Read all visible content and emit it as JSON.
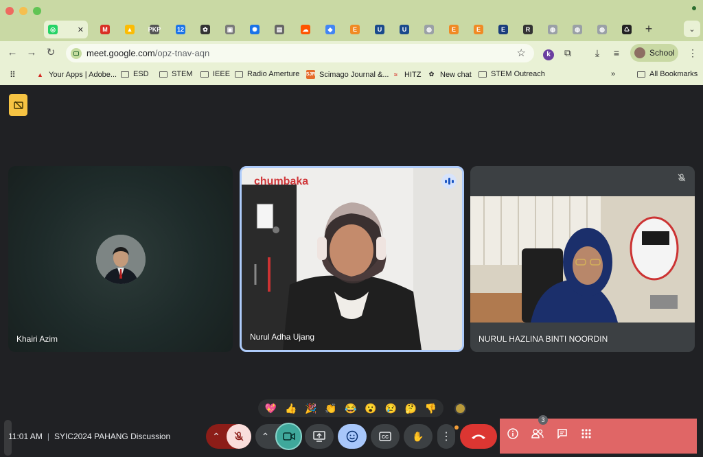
{
  "browser": {
    "tabs": [
      {
        "name": "whatsapp",
        "color": "#25d366",
        "glyph": "◎"
      },
      {
        "name": "gmail",
        "color": "#d93025",
        "glyph": "M"
      },
      {
        "name": "google-drive",
        "color": "#fbbc04",
        "glyph": "▲"
      },
      {
        "name": "pkp",
        "color": "#555555",
        "glyph": "PKP"
      },
      {
        "name": "calendar",
        "color": "#1a73e8",
        "glyph": "12"
      },
      {
        "name": "chatgpt",
        "color": "#333333",
        "glyph": "✿"
      },
      {
        "name": "portal",
        "color": "#7a7a7a",
        "glyph": "▣"
      },
      {
        "name": "settings",
        "color": "#1a73e8",
        "glyph": "✺"
      },
      {
        "name": "doc",
        "color": "#666666",
        "glyph": "▤"
      },
      {
        "name": "soundcloud",
        "color": "#ff5500",
        "glyph": "☁"
      },
      {
        "name": "layers",
        "color": "#4285f4",
        "glyph": "◆"
      },
      {
        "name": "elsevier-1",
        "color": "#f08a24",
        "glyph": "E"
      },
      {
        "name": "shield-1",
        "color": "#1a4a8c",
        "glyph": "U"
      },
      {
        "name": "shield-2",
        "color": "#1a4a8c",
        "glyph": "U"
      },
      {
        "name": "globe-1",
        "color": "#9aa0a6",
        "glyph": "◍"
      },
      {
        "name": "elsevier-2",
        "color": "#f08a24",
        "glyph": "E"
      },
      {
        "name": "elsevier-3",
        "color": "#f08a24",
        "glyph": "E"
      },
      {
        "name": "e-journal",
        "color": "#1a3d7c",
        "glyph": "E"
      },
      {
        "name": "researchgate",
        "color": "#333333",
        "glyph": "R"
      },
      {
        "name": "globe-2",
        "color": "#9aa0a6",
        "glyph": "◍"
      },
      {
        "name": "globe-3",
        "color": "#9aa0a6",
        "glyph": "◍"
      },
      {
        "name": "globe-4",
        "color": "#9aa0a6",
        "glyph": "◍"
      },
      {
        "name": "recycle",
        "color": "#222222",
        "glyph": "♺"
      }
    ],
    "url_host": "meet.google.com",
    "url_path": "/opz-tnav-aqn",
    "profile_label": "School",
    "extension_letter": "k",
    "bookmarks": [
      {
        "label": "Your Apps | Adobe...",
        "kind": "adobe"
      },
      {
        "label": "ESD",
        "kind": "folder"
      },
      {
        "label": "STEM",
        "kind": "folder"
      },
      {
        "label": "IEEE",
        "kind": "folder"
      },
      {
        "label": "Radio Amerture",
        "kind": "folder"
      },
      {
        "label": "Scimago Journal &...",
        "kind": "sjr"
      },
      {
        "label": "HITZ",
        "kind": "hitz"
      },
      {
        "label": "New chat",
        "kind": "chat"
      },
      {
        "label": "STEM Outreach",
        "kind": "folder"
      }
    ],
    "overflow_label": "»",
    "all_bookmarks_label": "All Bookmarks"
  },
  "meeting": {
    "participants": [
      {
        "name": "Khairi Azim",
        "state": "avatar"
      },
      {
        "name": "Nurul Adha Ujang",
        "state": "speaking"
      },
      {
        "name": "NURUL HAZLINA BINTI NOORDIN",
        "state": "muted"
      }
    ],
    "reactions": [
      "💖",
      "👍",
      "🎉",
      "👏",
      "😂",
      "😮",
      "😢",
      "🤔",
      "👎"
    ],
    "time": "11:01 AM",
    "separator": "|",
    "title": "SYIC2024 PAHANG Discussion",
    "people_count": "3",
    "colors": {
      "accent_speaking": "#aecbfa",
      "hangup": "#dc3632",
      "camera_on": "#3fa89b",
      "panel": "#e06666"
    }
  }
}
